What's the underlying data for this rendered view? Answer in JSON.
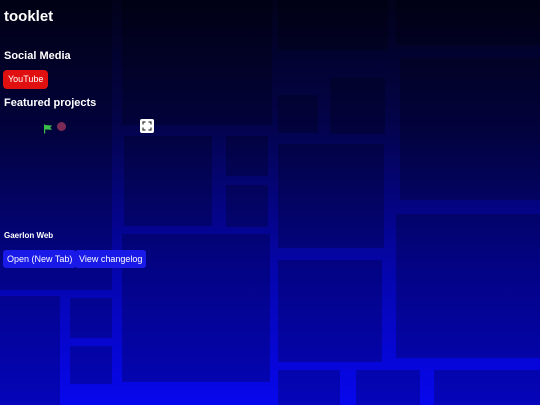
{
  "app": {
    "title": "tooklet"
  },
  "social": {
    "heading": "Social Media",
    "youtube_label": "YouTube"
  },
  "featured": {
    "heading": "Featured projects",
    "player_icons": [
      "green-flag-icon",
      "stop-icon",
      "fullscreen-icon"
    ],
    "project_name": "Gaerlon Web",
    "open_label": "Open (New Tab)",
    "changelog_label": "View changelog"
  },
  "colors": {
    "youtube_button": "#e01010",
    "action_button": "#1a1ae8",
    "flag": "#3cbf4a",
    "stop": "#7a2a55"
  }
}
